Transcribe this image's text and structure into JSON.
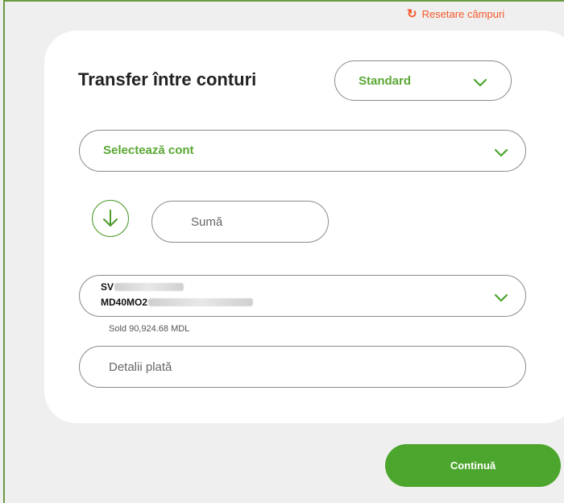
{
  "header": {
    "reset_icon": "↻",
    "reset_label": "Resetare câmpuri"
  },
  "form": {
    "title": "Transfer între conturi",
    "mode": {
      "selected": "Standard"
    },
    "destination_account": {
      "label": "Selectează cont"
    },
    "amount": {
      "placeholder": "Sumă",
      "value": ""
    },
    "source_account": {
      "line1_prefix": "SV",
      "line2_prefix": "MD40MO2",
      "balance_label": "Sold 90,924.68 MDL"
    },
    "details": {
      "placeholder": "Detalii plată",
      "value": ""
    },
    "continue_label": "Continuă"
  },
  "icons": {
    "reset": "refresh-icon",
    "chevron": "chevron-down-icon",
    "direction": "arrow-down-circle-icon"
  },
  "colors": {
    "accent_green": "#4ca52c",
    "label_green": "#5aa733",
    "reset_orange": "#f5592a",
    "frame_green": "#6b9a45"
  }
}
